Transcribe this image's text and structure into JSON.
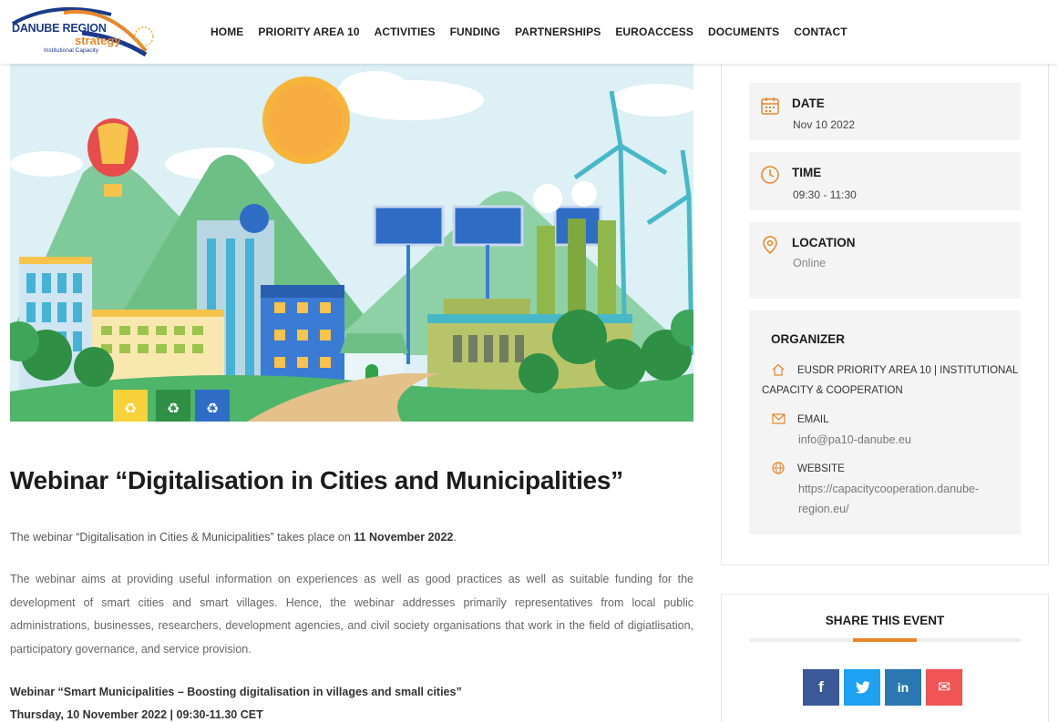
{
  "logo": {
    "line1": "DANUBE REGION",
    "line2": "strategy",
    "line3": "Institutional Capacity"
  },
  "nav": [
    "HOME",
    "PRIORITY AREA 10",
    "ACTIVITIES",
    "FUNDING",
    "PARTNERSHIPS",
    "EUROACCESS",
    "DOCUMENTS",
    "CONTACT"
  ],
  "article": {
    "title": "Webinar “Digitalisation in Cities and Municipalities”",
    "p1_prefix": "The webinar “Digitalisation in Cities & Municipalities” takes place on ",
    "p1_bold": "11 November 2022",
    "p1_suffix": ".",
    "p2": "The webinar aims at providing useful information on  experiences as well as good practices as well as suitable funding for the development of smart cities and smart villages. Hence, the webinar addresses primarily representatives from local public administrations, businesses, researchers, development agencies, and civil society organisations that work in the field of digiatlisation, participatory governance, and service provision.",
    "p3_line1": "Webinar “Smart Municipalities – Boosting digitalisation in villages and small cities”",
    "p3_line2": "Thursday, 10 November 2022 | 09:30-11.30 CET"
  },
  "event": {
    "date_label": "DATE",
    "date_value": "Nov 10 2022",
    "time_label": "TIME",
    "time_value": "09:30 - 11:30",
    "location_label": "LOCATION",
    "location_value": "Online"
  },
  "organizer": {
    "title": "ORGANIZER",
    "name_line1": "EUSDR PRIORITY AREA 10 | INSTITUTIONAL",
    "name_line2": "CAPACITY & COOPERATION",
    "email_label": "EMAIL",
    "email_value": "info@pa10-danube.eu",
    "website_label": "WEBSITE",
    "website_line1": "https://capacitycooperation.danube-",
    "website_line2": "region.eu/"
  },
  "share": {
    "title": "SHARE THIS EVENT",
    "buttons": [
      {
        "glyph": "f",
        "color": "#3b5998"
      },
      {
        "glyph": "t",
        "color": "#1da1f2"
      },
      {
        "glyph": "in",
        "color": "#2b78b0"
      },
      {
        "glyph": "✉",
        "color": "#f05454"
      }
    ]
  },
  "colors": {
    "accent": "#e8872a",
    "brand_blue": "#1b3a8c"
  }
}
